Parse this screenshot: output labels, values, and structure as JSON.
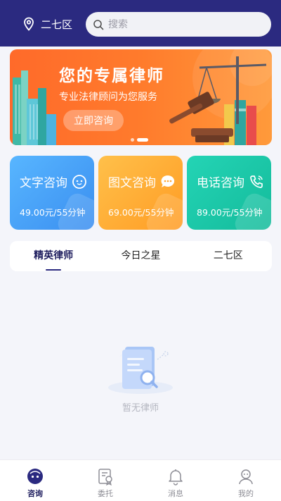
{
  "header": {
    "location": "二七区",
    "search_placeholder": "搜索"
  },
  "banner": {
    "title": "您的专属律师",
    "subtitle": "专业法律顾问为您服务",
    "button": "立即咨询",
    "slide_count": 2,
    "active_slide": 2
  },
  "services": [
    {
      "title": "文字咨询",
      "price": "49.00元/55分钟",
      "icon": "chat-bubble-icon",
      "color": "#4aa6fb"
    },
    {
      "title": "图文咨询",
      "price": "69.00元/55分钟",
      "icon": "message-dots-icon",
      "color": "#ffae35"
    },
    {
      "title": "电话咨询",
      "price": "89.00元/55分钟",
      "icon": "phone-icon",
      "color": "#1ec8a8"
    }
  ],
  "lawyer_tabs": [
    {
      "label": "精英律师",
      "active": true
    },
    {
      "label": "今日之星",
      "active": false
    },
    {
      "label": "二七区",
      "active": false
    }
  ],
  "empty_state": {
    "text": "暂无律师"
  },
  "tabbar": [
    {
      "label": "咨询",
      "icon": "consult-icon",
      "active": true
    },
    {
      "label": "委托",
      "icon": "entrust-icon",
      "active": false
    },
    {
      "label": "消息",
      "icon": "bell-icon",
      "active": false
    },
    {
      "label": "我的",
      "icon": "profile-icon",
      "active": false
    }
  ],
  "colors": {
    "brand": "#2b2a80",
    "banner": "#ff7b2c"
  }
}
